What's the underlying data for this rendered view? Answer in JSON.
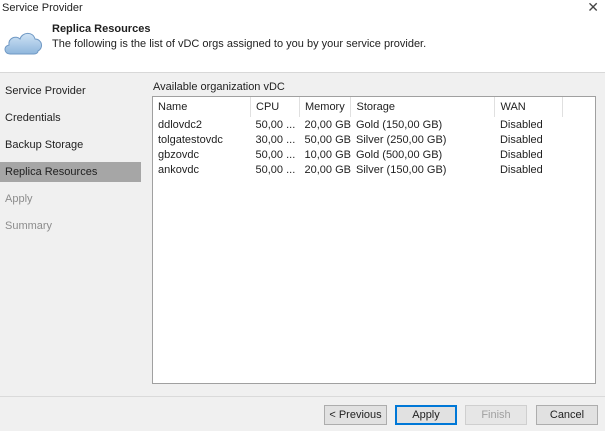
{
  "window": {
    "title": "Service Provider"
  },
  "header": {
    "title": "Replica Resources",
    "subtitle": "The following is the list of vDC orgs assigned to you by your service provider."
  },
  "sidebar": {
    "items": [
      {
        "label": "Service Provider",
        "state": "normal"
      },
      {
        "label": "Credentials",
        "state": "normal"
      },
      {
        "label": "Backup Storage",
        "state": "normal"
      },
      {
        "label": "Replica Resources",
        "state": "active"
      },
      {
        "label": "Apply",
        "state": "disabled"
      },
      {
        "label": "Summary",
        "state": "disabled"
      }
    ]
  },
  "main": {
    "section_label": "Available organization vDC",
    "columns": [
      "Name",
      "CPU",
      "Memory",
      "Storage",
      "WAN"
    ],
    "rows": [
      [
        "ddlovdc2",
        "50,00 ...",
        "20,00 GB",
        "Gold (150,00 GB)",
        "Disabled"
      ],
      [
        "tolgatestovdc",
        "30,00 ...",
        "50,00 GB",
        "Silver (250,00 GB)",
        "Disabled"
      ],
      [
        "gbzovdc",
        "50,00 ...",
        "10,00 GB",
        "Gold (500,00 GB)",
        "Disabled"
      ],
      [
        "ankovdc",
        "50,00 ...",
        "20,00 GB",
        "Silver (150,00 GB)",
        "Disabled"
      ]
    ]
  },
  "footer": {
    "previous_label": "< Previous",
    "apply_label": "Apply",
    "finish_label": "Finish",
    "cancel_label": "Cancel"
  },
  "icons": {
    "header_icon": "cloud-icon",
    "close": "close-icon"
  },
  "colors": {
    "accent": "#0078d7",
    "active_nav": "#a6a6a6",
    "panel": "#f0f0f0"
  }
}
